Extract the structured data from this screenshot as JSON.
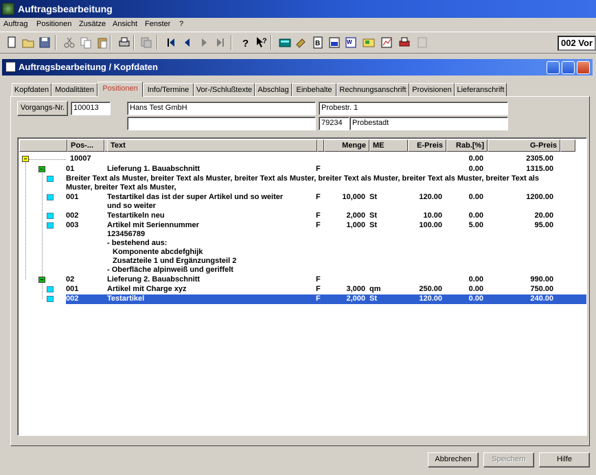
{
  "app": {
    "title": "Auftragsbearbeitung"
  },
  "menu": [
    "Auftrag",
    "Positionen",
    "Zusätze",
    "Ansicht",
    "Fenster",
    "?"
  ],
  "toolbar": {
    "combo_value": "002 Vor",
    "buttons": [
      "new-icon",
      "open-icon",
      "save-icon",
      "cut-icon",
      "copy-icon",
      "paste-icon",
      "print-icon",
      "preview-icon",
      "first-record-icon",
      "prev-record-icon",
      "next-record-icon",
      "last-record-icon",
      "help-icon",
      "context-help-icon",
      "calculator-icon",
      "tools-icon",
      "document-icon",
      "report-icon",
      "word-icon",
      "folder-icon",
      "chart-icon",
      "printer-icon",
      "disabled-icon"
    ]
  },
  "window": {
    "title": "Auftragsbearbeitung / Kopfdaten"
  },
  "tabs": [
    "Kopfdaten",
    "Modalitäten",
    "Positionen",
    "Info/Termine",
    "Vor-/Schlußtexte",
    "Abschlag",
    "Einbehalte",
    "Rechnungsanschrift",
    "Provisionen",
    "Lieferanschrift"
  ],
  "active_tab": "Positionen",
  "header": {
    "vorgang_button": "Vorgangs-Nr.",
    "vorgang_nr": "100013",
    "name": "Hans Test GmbH",
    "name2": "",
    "street": "Probestr. 1",
    "zip": "79234",
    "city": "Probestadt"
  },
  "grid": {
    "columns": [
      "Pos-...",
      "Text",
      "Menge",
      "ME",
      "E-Preis",
      "Rab.[%]",
      "G-Preis"
    ],
    "rows": [
      {
        "level": 0,
        "node": "yellow",
        "pos": "10007",
        "text": "",
        "flag": "",
        "menge": "",
        "me": "",
        "epreis": "",
        "rab": "0.00",
        "gpreis": "2305.00"
      },
      {
        "level": 1,
        "node": "green",
        "pos": "01",
        "text": "Lieferung 1. Bauabschnitt",
        "flag": "F",
        "menge": "",
        "me": "",
        "epreis": "",
        "rab": "0.00",
        "gpreis": "1315.00"
      },
      {
        "level": 2,
        "node": "cyan",
        "pos": "",
        "text": "Breiter Text als Muster, breiter Text als Muster, breiter Text als Muster, breiter Text als Muster, breiter Text als Muster, breiter Text als Muster, breiter Text als Muster,",
        "wide": true,
        "flag": "",
        "menge": "",
        "me": "",
        "epreis": "",
        "rab": "",
        "gpreis": ""
      },
      {
        "level": 2,
        "node": "cyan",
        "pos": "001",
        "text": "Testartikel  das ist der super Artikel und so weiter und so weiter",
        "flag": "F",
        "menge": "10,000",
        "me": "St",
        "epreis": "120.00",
        "rab": "0.00",
        "gpreis": "1200.00"
      },
      {
        "level": 2,
        "node": "cyan",
        "pos": "002",
        "text": "Testartikeln neu",
        "flag": "F",
        "menge": "2,000",
        "me": "St",
        "epreis": "10.00",
        "rab": "0.00",
        "gpreis": "20.00"
      },
      {
        "level": 2,
        "node": "cyan",
        "pos": "003",
        "text": "Artikel mit Seriennummer",
        "extra": [
          "123456789",
          "- bestehend aus:",
          "  Komponente abcdefghijk",
          "  Zusatzteile 1 und Ergänzungsteil 2",
          "- Oberfläche alpinweiß und geriffelt"
        ],
        "flag": "F",
        "menge": "1,000",
        "me": "St",
        "epreis": "100.00",
        "rab": "5.00",
        "gpreis": "95.00"
      },
      {
        "level": 1,
        "node": "green",
        "pos": "02",
        "text": "Lieferung 2. Bauabschnitt",
        "flag": "F",
        "menge": "",
        "me": "",
        "epreis": "",
        "rab": "0.00",
        "gpreis": "990.00"
      },
      {
        "level": 2,
        "node": "cyan",
        "pos": "001",
        "text": "Artikel mit Charge xyz",
        "flag": "F",
        "menge": "3,000",
        "me": "qm",
        "epreis": "250.00",
        "rab": "0.00",
        "gpreis": "750.00"
      },
      {
        "level": 2,
        "node": "cyan",
        "pos": "002",
        "text": "Testartikel",
        "flag": "F",
        "menge": "2,000",
        "me": "St",
        "epreis": "120.00",
        "rab": "0.00",
        "gpreis": "240.00",
        "selected": true
      }
    ]
  },
  "footer": {
    "cancel": "Abbrechen",
    "save": "Speichern",
    "help": "Hilfe"
  }
}
